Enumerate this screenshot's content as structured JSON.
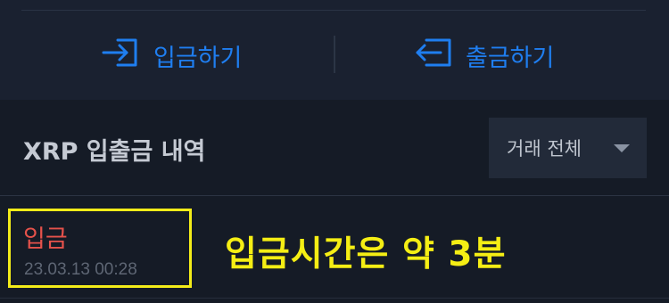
{
  "actions": {
    "deposit_label": "입금하기",
    "withdraw_label": "출금하기"
  },
  "history": {
    "title": "XRP 입출금 내역",
    "filter_value": "거래 전체"
  },
  "transactions": [
    {
      "type": "입금",
      "time": "23.03.13 00:28"
    }
  ],
  "annotation": "입금시간은 약 3분",
  "colors": {
    "background": "#151b26",
    "panel": "#1a2130",
    "accent_blue": "#1f7ef0",
    "deposit_red": "#e5524b",
    "highlight_yellow": "#f3ec19"
  },
  "icons": {
    "deposit": "deposit-arrow-icon",
    "withdraw": "withdraw-arrow-icon",
    "filter_caret": "caret-down-icon"
  }
}
